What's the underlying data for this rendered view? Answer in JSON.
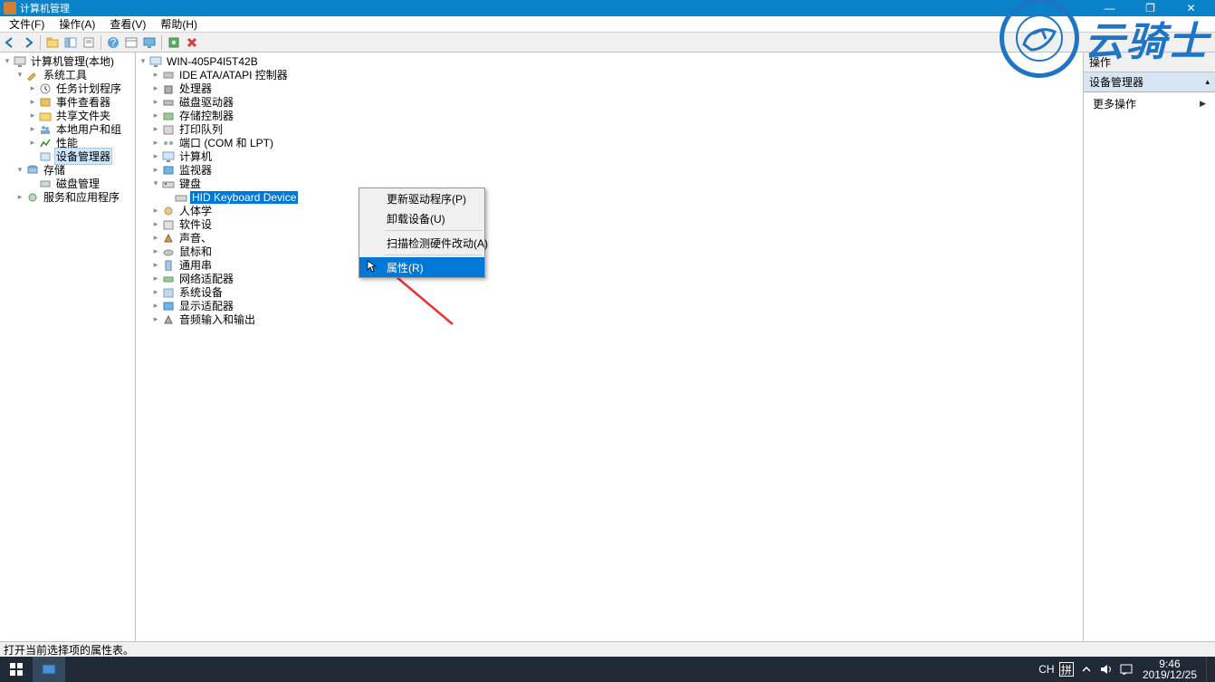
{
  "window": {
    "title": "计算机管理",
    "minimize": "—",
    "maximize": "❐",
    "close": "✕"
  },
  "menubar": {
    "file": "文件(F)",
    "action": "操作(A)",
    "view": "查看(V)",
    "help": "帮助(H)"
  },
  "toolbar_icons": {
    "back": "back-arrow-icon",
    "forward": "forward-arrow-icon",
    "up": "folder-up-icon",
    "show_hide_tree": "show-tree-icon",
    "properties": "properties-icon",
    "help": "help-icon",
    "refresh": "refresh-icon",
    "monitor": "monitor-icon",
    "device": "device-icon",
    "delete": "delete-icon"
  },
  "left_tree": {
    "root": "计算机管理(本地)",
    "system_tools": {
      "label": "系统工具",
      "items": [
        "任务计划程序",
        "事件查看器",
        "共享文件夹",
        "本地用户和组",
        "性能",
        "设备管理器"
      ]
    },
    "storage": {
      "label": "存储",
      "items": [
        "磁盘管理"
      ]
    },
    "services": "服务和应用程序"
  },
  "center_tree": {
    "root": "WIN-405P4I5T42B",
    "items": [
      "IDE ATA/ATAPI 控制器",
      "处理器",
      "磁盘驱动器",
      "存储控制器",
      "打印队列",
      "端口 (COM 和 LPT)",
      "计算机",
      "监视器",
      "键盘",
      "人体学",
      "软件设",
      "声音、",
      "鼠标和",
      "通用串",
      "网络适配器",
      "系统设备",
      "显示适配器",
      "音频输入和输出"
    ],
    "keyboard_child": "HID Keyboard Device"
  },
  "context_menu": {
    "update_driver": "更新驱动程序(P)",
    "uninstall": "卸载设备(U)",
    "scan": "扫描检测硬件改动(A)",
    "properties": "属性(R)"
  },
  "right_pane": {
    "header": "操作",
    "group": "设备管理器",
    "more": "更多操作"
  },
  "statusbar": {
    "text": "打开当前选择项的属性表。"
  },
  "taskbar": {
    "ime_lang": "CH",
    "ime_mode": "拼",
    "time": "9:46",
    "date": "2019/12/25"
  },
  "watermark": {
    "text": "云骑士"
  }
}
